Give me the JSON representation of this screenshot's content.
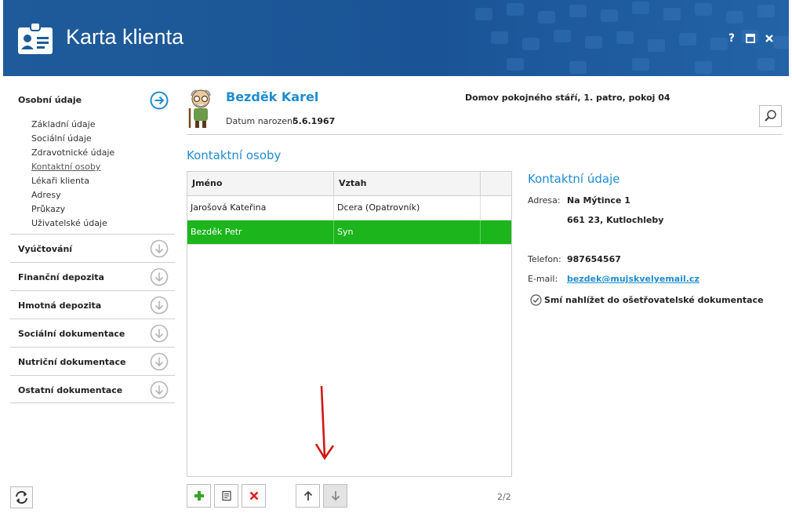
{
  "window": {
    "title": "Karta klienta",
    "help_label": "?",
    "colors": {
      "header": "#1f5b9a",
      "accent": "#1f8ccf",
      "selected_row": "#1cb51c"
    }
  },
  "nav": {
    "active_section": "Osobní údaje",
    "subitems": [
      {
        "label": "Základní údaje"
      },
      {
        "label": "Sociální údaje"
      },
      {
        "label": "Zdravotnické údaje"
      },
      {
        "label": "Kontaktní osoby"
      },
      {
        "label": "Lékaři klienta"
      },
      {
        "label": "Adresy"
      },
      {
        "label": "Průkazy"
      },
      {
        "label": "Uživatelské údaje"
      }
    ],
    "sections": [
      {
        "label": "Vyúčtování"
      },
      {
        "label": "Finanční depozita"
      },
      {
        "label": "Hmotná depozita"
      },
      {
        "label": "Sociální dokumentace"
      },
      {
        "label": "Nutriční dokumentace"
      },
      {
        "label": "Ostatní dokumentace"
      }
    ]
  },
  "client": {
    "name": "Bezděk Karel",
    "dob_label": "Datum narození:",
    "dob": "5.6.1967",
    "location": "Domov pokojného stáří, 1. patro, pokoj 04"
  },
  "contacts": {
    "title": "Kontaktní osoby",
    "columns": [
      "Jméno",
      "Vztah"
    ],
    "rows": [
      {
        "name": "Jarošová Kateřina",
        "relation": "Dcera (Opatrovník)"
      },
      {
        "name": "Bezděk Petr",
        "relation": "Syn"
      }
    ],
    "pager": "2/2"
  },
  "details": {
    "title": "Kontaktní údaje",
    "address_label": "Adresa:",
    "address_line1": "Na Mýtince 1",
    "address_line2": "661 23, Kutlochleby",
    "phone_label": "Telefon:",
    "phone": "987654567",
    "email_label": "E-mail:",
    "email": "bezdek@mujskvelyemail.cz",
    "permission": "Smí nahlížet do ošetřovatelské dokumentace"
  }
}
